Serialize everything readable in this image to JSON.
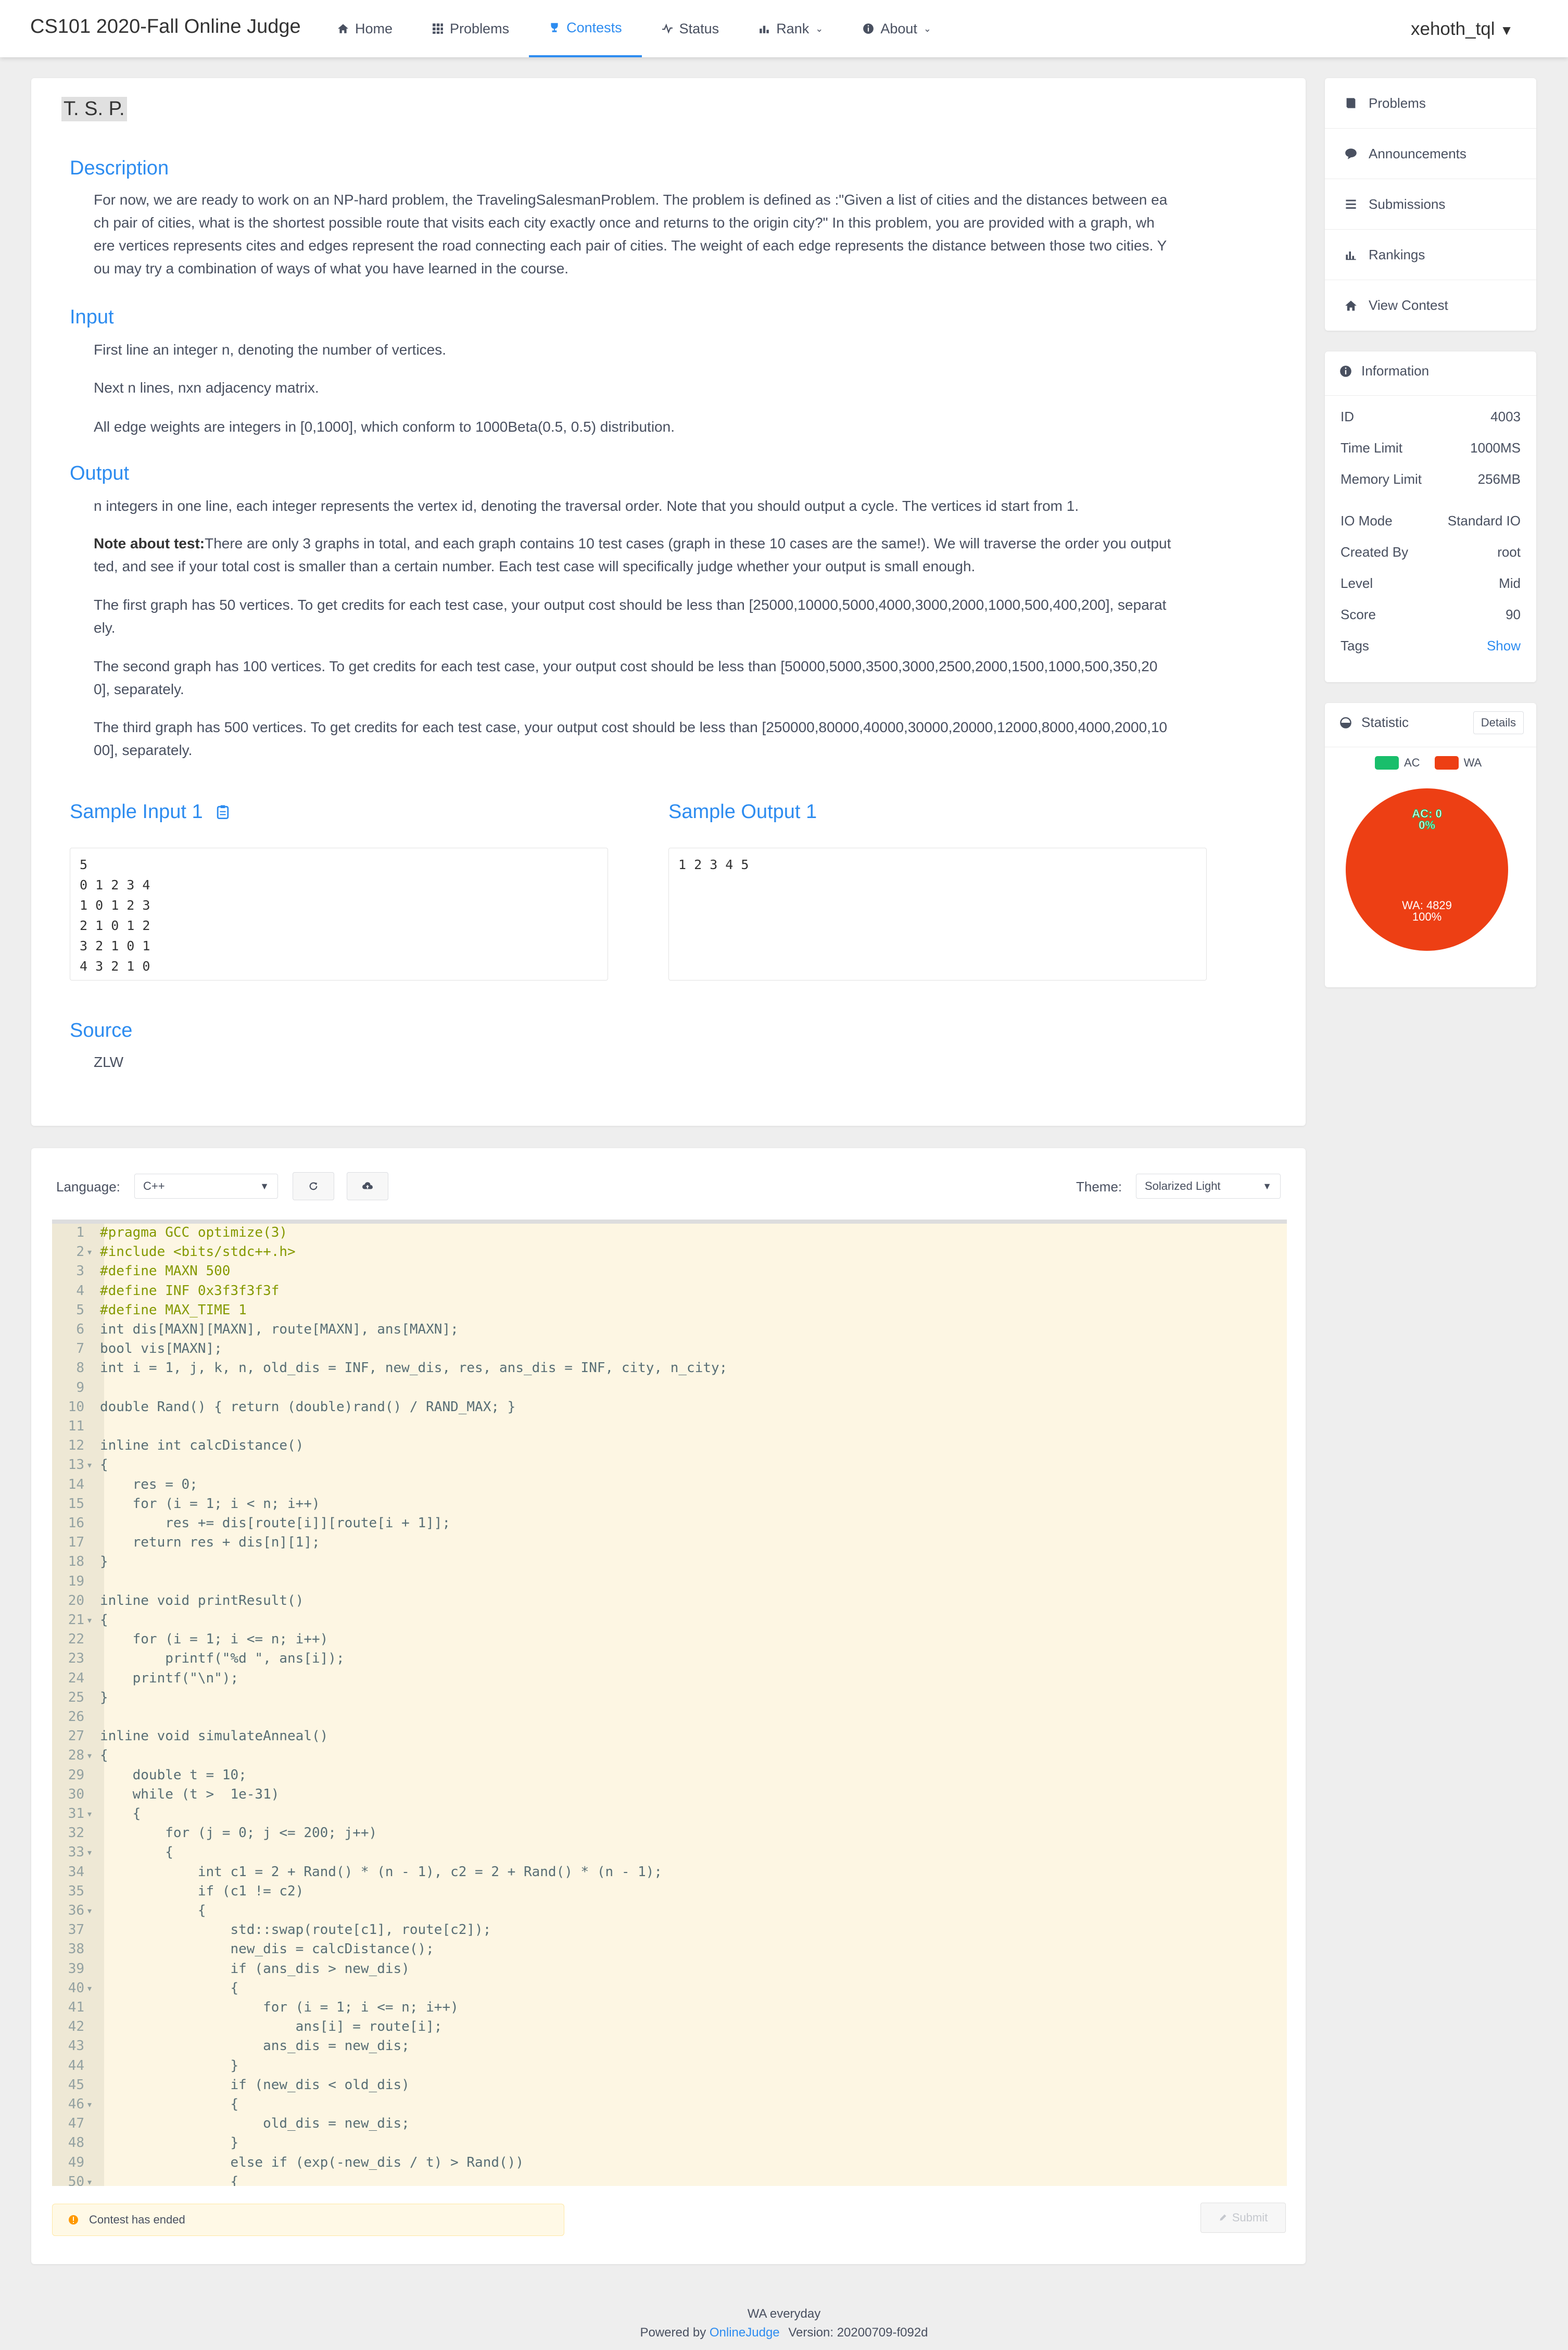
{
  "nav": {
    "title": "CS101 2020-Fall Online Judge",
    "items": [
      {
        "label": "Home",
        "icon": "home-icon"
      },
      {
        "label": "Problems",
        "icon": "grid-icon"
      },
      {
        "label": "Contests",
        "icon": "trophy-icon"
      },
      {
        "label": "Status",
        "icon": "pulse-icon"
      },
      {
        "label": "Rank",
        "icon": "bar-chart-icon"
      },
      {
        "label": "About",
        "icon": "info-icon"
      }
    ],
    "user": "xehoth_tql"
  },
  "problem": {
    "title": "T. S. P.",
    "description_heading": "Description",
    "description": [
      "For now, we are ready to work on an NP-hard problem, the TravelingSalesmanProblem. The problem is defined as :\"Given a list of cities and the distances between ea",
      "ch pair of cities, what is the shortest possible route that visits each city exactly once and returns to the origin city?\" In this problem, you are provided with a graph, wh",
      "ere vertices represents cites and edges represent the road connecting each pair of cities. The weight of each edge represents the distance between those two cities. Y",
      "ou may try a combination of ways of what you have learned in the course."
    ],
    "input_heading": "Input",
    "input": [
      "First line an integer n, denoting the number of vertices.",
      "Next n lines, nxn adjacency matrix.",
      "All edge weights are integers in [0,1000], which conform to 1000Beta(0.5, 0.5) distribution."
    ],
    "output_heading": "Output",
    "output_line": "n integers in one line, each integer represents the vertex id, denoting the traversal order. Note that you should output a cycle. The vertices id start from 1.",
    "note_label": "Note about test:",
    "note": "There are only 3 graphs in total, and each graph contains 10 test cases (graph in these 10 cases are the same!). We will traverse the order you output",
    "note2": "ted, and see if your total cost is smaller than a certain number. Each test case will specifically judge whether your output is small enough.",
    "graph1a": "The first graph has 50 vertices. To get credits for each test case, your output cost should be less than [25000,10000,5000,4000,3000,2000,1000,500,400,200], separat",
    "graph1b": "ely.",
    "graph2a": "The second graph has 100 vertices. To get credits for each test case, your output cost should be less than [50000,5000,3500,3000,2500,2000,1500,1000,500,350,20",
    "graph2b": "0], separately.",
    "graph3a": "The third graph has 500 vertices. To get credits for each test case, your output cost should be less than [250000,80000,40000,30000,20000,12000,8000,4000,2000,10",
    "graph3b": "00], separately.",
    "sample_input_heading": "Sample Input 1",
    "sample_input": "5\n0 1 2 3 4\n1 0 1 2 3\n2 1 0 1 2\n3 2 1 0 1\n4 3 2 1 0",
    "sample_output_heading": "Sample Output 1",
    "sample_output": "1 2 3 4 5",
    "source_heading": "Source",
    "source": "ZLW"
  },
  "sidebar": {
    "menu": [
      {
        "label": "Problems",
        "icon": "book-icon"
      },
      {
        "label": "Announcements",
        "icon": "chat-icon"
      },
      {
        "label": "Submissions",
        "icon": "list-icon"
      },
      {
        "label": "Rankings",
        "icon": "stats-icon"
      },
      {
        "label": "View Contest",
        "icon": "home-icon"
      }
    ],
    "info_title": "Information",
    "info": [
      {
        "k": "ID",
        "v": "4003"
      },
      {
        "k": "Time Limit",
        "v": "1000MS"
      },
      {
        "k": "Memory Limit",
        "v": "256MB"
      },
      {
        "k": "IO Mode",
        "v": "Standard IO"
      },
      {
        "k": "Created By",
        "v": "root"
      },
      {
        "k": "Level",
        "v": "Mid"
      },
      {
        "k": "Score",
        "v": "90"
      },
      {
        "k": "Tags",
        "v": "Show"
      }
    ],
    "stat_title": "Statistic",
    "details": "Details",
    "legend_ac": "AC",
    "legend_wa": "WA",
    "pie_ac_label": "AC: 0",
    "pie_ac_pct": "0%",
    "pie_wa_label": "WA: 4829",
    "pie_wa_pct": "100%",
    "ac_color": "#19be6b",
    "wa_color": "#ed3f14"
  },
  "chart_data": {
    "type": "pie",
    "categories": [
      "AC",
      "WA"
    ],
    "values": [
      0,
      4829
    ]
  },
  "editor": {
    "language_label": "Language:",
    "language": "C++",
    "theme_label": "Theme:",
    "theme": "Solarized Light",
    "code": [
      "#pragma GCC optimize(3)",
      "#include <bits/stdc++.h>",
      "#define MAXN 500",
      "#define INF 0x3f3f3f3f",
      "#define MAX_TIME 1",
      "int dis[MAXN][MAXN], route[MAXN], ans[MAXN];",
      "bool vis[MAXN];",
      "int i = 1, j, k, n, old_dis = INF, new_dis, res, ans_dis = INF, city, n_city;",
      "",
      "double Rand() { return (double)rand() / RAND_MAX; }",
      "",
      "inline int calcDistance()",
      "{",
      "    res = 0;",
      "    for (i = 1; i < n; i++)",
      "        res += dis[route[i]][route[i + 1]];",
      "    return res + dis[n][1];",
      "}",
      "",
      "inline void printResult()",
      "{",
      "    for (i = 1; i <= n; i++)",
      "        printf(\"%d \", ans[i]);",
      "    printf(\"\\n\");",
      "}",
      "",
      "inline void simulateAnneal()",
      "{",
      "    double t = 10;",
      "    while (t >  1e-31)",
      "    {",
      "        for (j = 0; j <= 200; j++)",
      "        {",
      "            int c1 = 2 + Rand() * (n - 1), c2 = 2 + Rand() * (n - 1);",
      "            if (c1 != c2)",
      "            {",
      "                std::swap(route[c1], route[c2]);",
      "                new_dis = calcDistance();",
      "                if (ans_dis > new_dis)",
      "                {",
      "                    for (i = 1; i <= n; i++)",
      "                        ans[i] = route[i];",
      "                    ans_dis = new_dis;",
      "                }",
      "                if (new_dis < old_dis)",
      "                {",
      "                    old_dis = new_dis;",
      "                }",
      "                else if (exp(-new_dis / t) > Rand())",
      "                {"
    ],
    "folds": [
      2,
      13,
      21,
      28,
      31,
      33,
      36,
      40,
      46,
      50
    ],
    "status": "Contest has ended",
    "submit": "Submit"
  },
  "footer": {
    "line1": "WA everyday",
    "powered": "Powered by",
    "oj": "OnlineJudge",
    "version": "Version: 20200709-f092d"
  }
}
